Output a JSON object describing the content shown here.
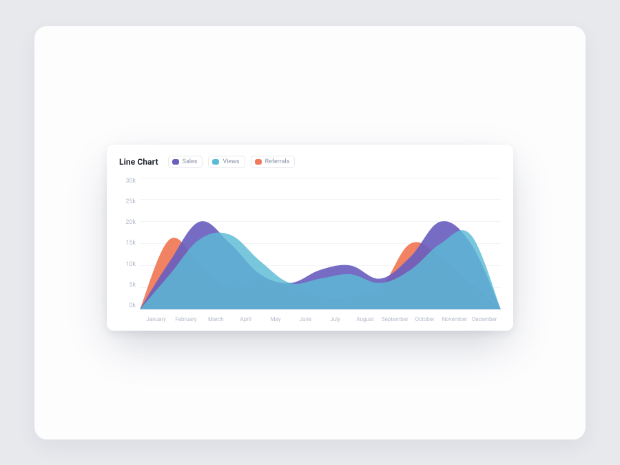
{
  "header": {
    "title": "Line Chart",
    "legend": [
      {
        "name": "Sales",
        "color": "#6a5fbf"
      },
      {
        "name": "Views",
        "color": "#5bbbd6"
      },
      {
        "name": "Referrals",
        "color": "#f07b5a"
      }
    ]
  },
  "yaxis_ticks": [
    "30k",
    "25k",
    "20k",
    "15k",
    "10k",
    "5k",
    "0k"
  ],
  "xaxis_ticks": [
    "January",
    "February",
    "March",
    "April",
    "May",
    "June",
    "July",
    "August",
    "September",
    "October",
    "November",
    "December"
  ],
  "colors": {
    "sales": "#6a5fbf",
    "views": "#5bbbd6",
    "referrals": "#f07b5a"
  },
  "chart_data": {
    "type": "area",
    "title": "Line Chart",
    "xlabel": "",
    "ylabel": "",
    "ylim": [
      0,
      30
    ],
    "categories": [
      "January",
      "February",
      "March",
      "April",
      "May",
      "June",
      "July",
      "August",
      "September",
      "October",
      "November",
      "December"
    ],
    "series": [
      {
        "name": "Sales",
        "values": [
          0,
          11,
          20,
          15,
          8,
          6,
          9,
          10,
          7,
          12,
          20,
          15,
          0
        ]
      },
      {
        "name": "Views",
        "values": [
          0,
          8,
          16,
          17,
          11,
          6,
          7,
          8,
          6,
          9,
          15,
          17,
          0
        ]
      },
      {
        "name": "Referrals",
        "values": [
          0,
          16,
          10,
          5,
          7,
          5,
          3,
          3,
          5,
          15,
          12,
          6,
          0
        ]
      }
    ],
    "legend_position": "top"
  }
}
